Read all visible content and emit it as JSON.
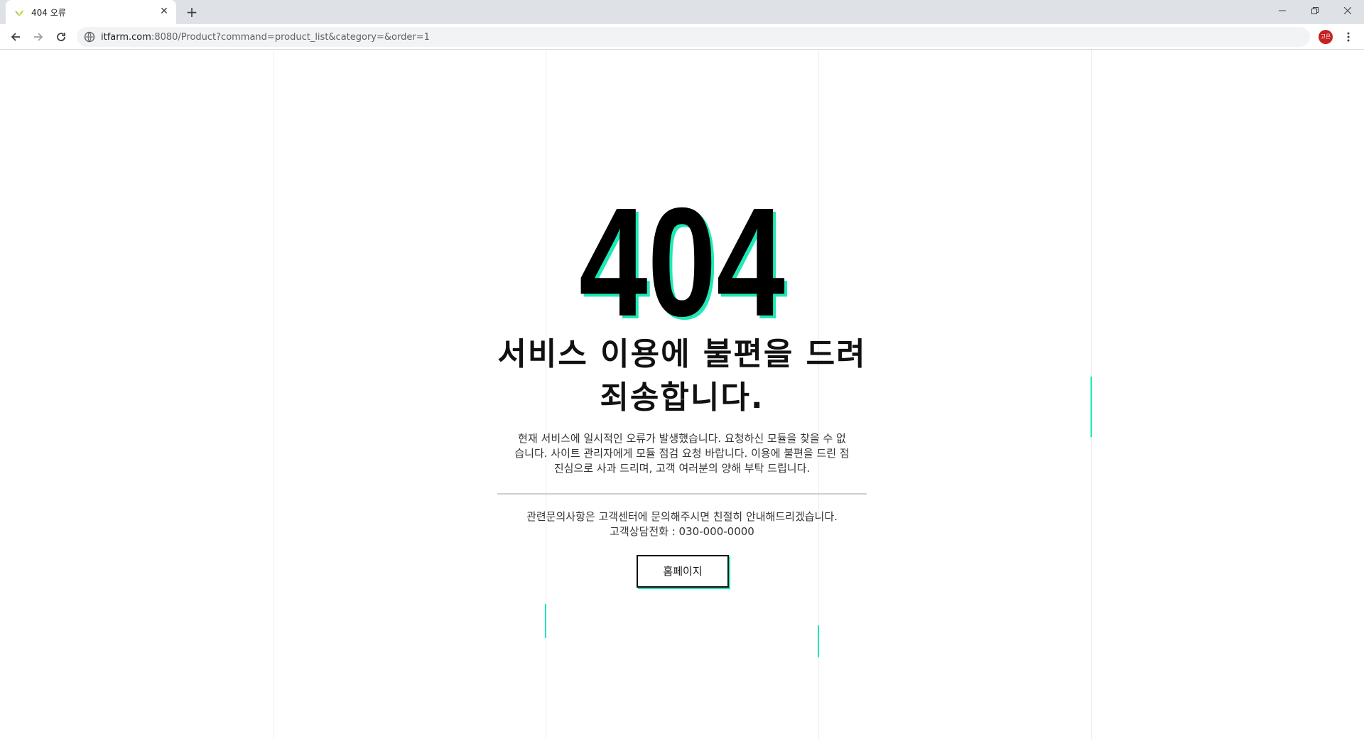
{
  "browser": {
    "tab_title": "404 오류",
    "new_tab": "+",
    "url_host": "itfarm.com",
    "url_rest": ":8080/Product?command=product_list&category=&order=1",
    "profile_initials": "고은"
  },
  "page": {
    "error_code": "404",
    "headline_line1": "서비스 이용에 불편을 드려",
    "headline_line2": "죄송합니다.",
    "description": [
      "현재 서비스에 일시적인 오류가 발생했습니다. 요청하신 모듈을 찾을 수 없",
      "습니다. 사이트 관리자에게 모듈 점검 요청 바랍니다. 이용에 불편을 드린 점",
      "진심으로 사과 드리며, 고객 여러분의 양해 부탁 드립니다."
    ],
    "contact_line": "관련문의사항은 고객센터에 문의해주시면 친절히 안내해드리겠습니다.",
    "phone_line": "고객상담전화 : 030-000-0000",
    "home_button": "홈페이지"
  },
  "colors": {
    "accent": "#1de9b6",
    "text": "#111111",
    "profile": "#c5221f"
  }
}
